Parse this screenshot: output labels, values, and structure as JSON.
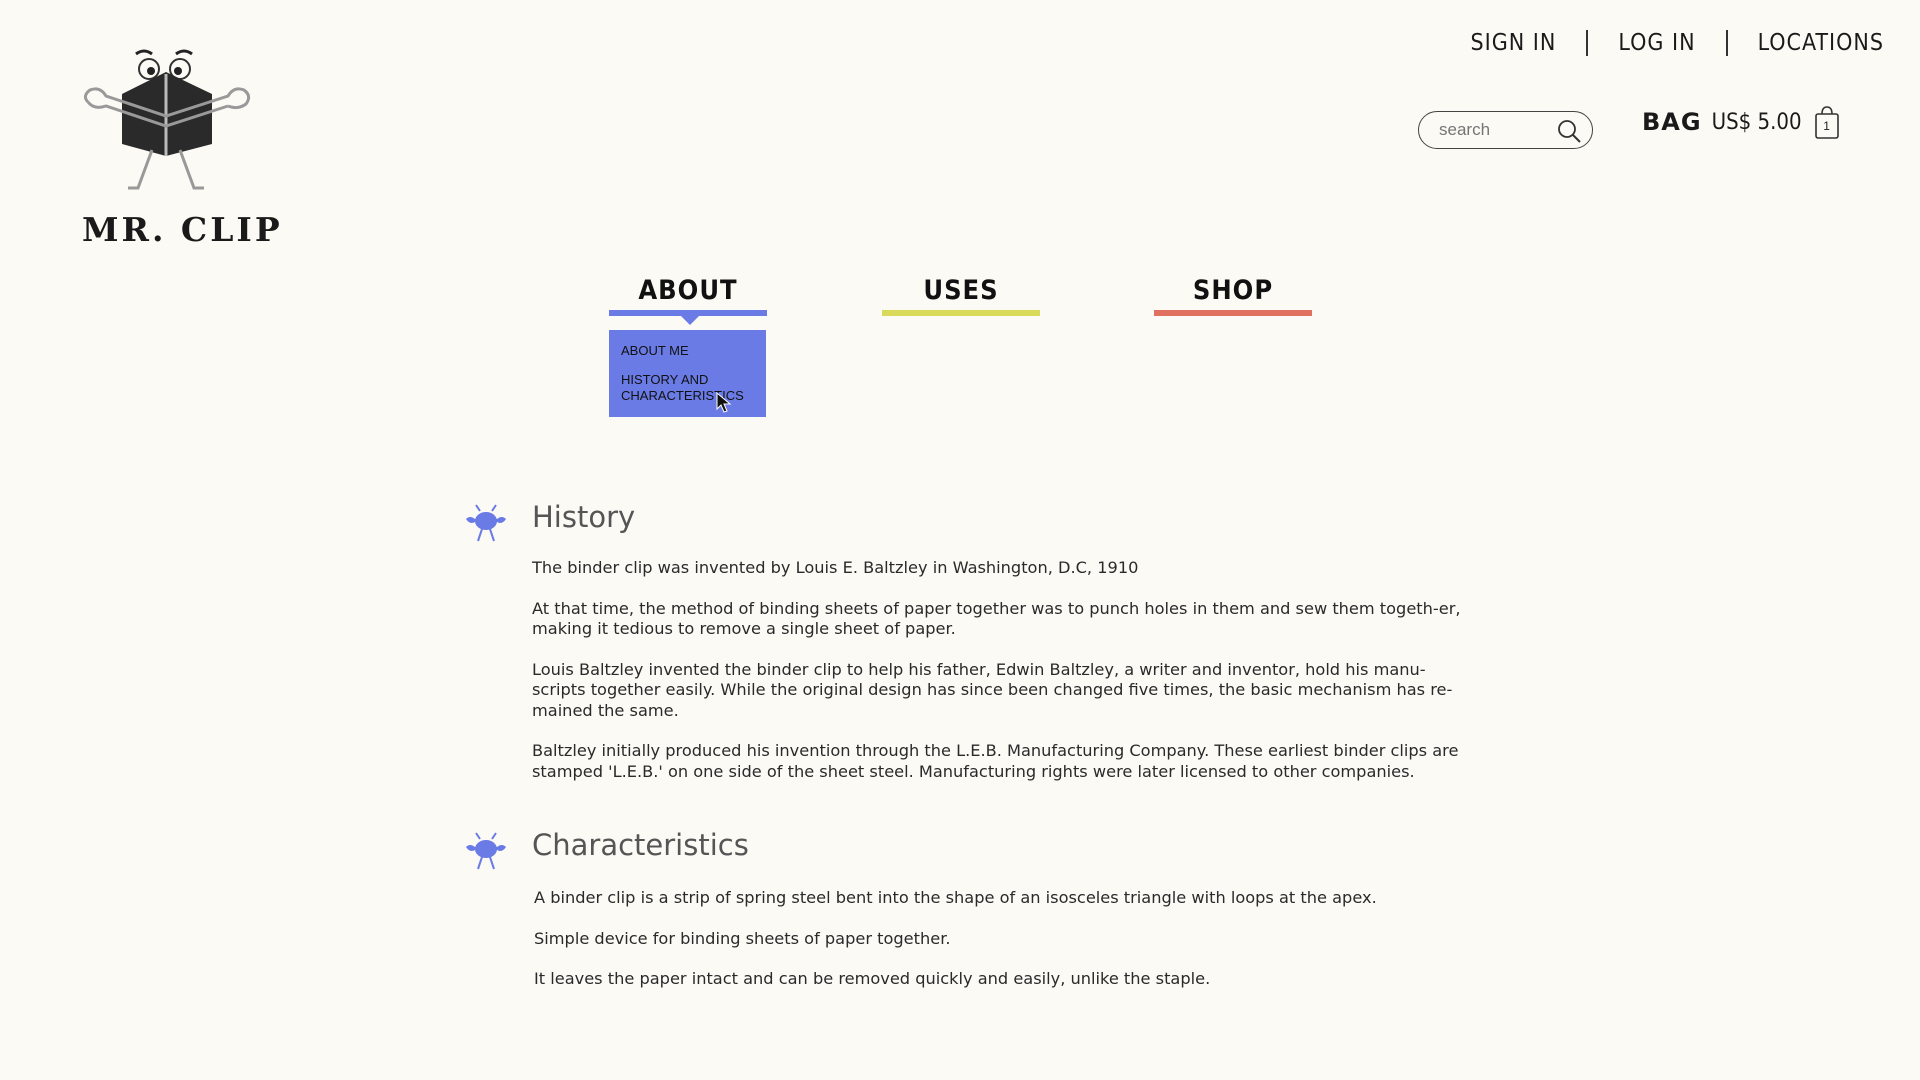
{
  "brand": {
    "name": "MR. CLIP"
  },
  "top_links": {
    "sign_in": "SIGN IN",
    "log_in": "LOG IN",
    "locations": "LOCATIONS"
  },
  "search": {
    "placeholder": "search"
  },
  "bag": {
    "label": "BAG",
    "price": "US$ 5.00",
    "count": "1"
  },
  "nav": {
    "items": [
      {
        "label": "ABOUT",
        "color": "#6a7be5"
      },
      {
        "label": "USES",
        "color": "#d9d95a"
      },
      {
        "label": "SHOP",
        "color": "#e0705f"
      }
    ],
    "dropdown": {
      "items": [
        "ABOUT ME",
        "HISTORY AND CHARACTERISTICS"
      ]
    }
  },
  "history": {
    "title": "History",
    "paragraphs": [
      "The binder clip was invented by Louis E. Baltzley in Washington, D.C, 1910",
      "At that time, the method of binding sheets of paper together was to punch holes in them and sew them togeth-er, making it tedious to remove a single sheet of paper.",
      "Louis Baltzley invented the binder clip to help his father, Edwin Baltzley, a writer and inventor, hold his manu-scripts together easily. While the original design has since been changed five times, the basic mechanism has re-mained the same.",
      "Baltzley initially produced his invention through the L.E.B. Manufacturing Company. These earliest binder clips are stamped 'L.E.B.' on one side of the sheet steel. Manufacturing rights were later licensed to other companies."
    ]
  },
  "characteristics": {
    "title": "Characteristics",
    "paragraphs": [
      "A binder clip is a strip of spring steel bent into the shape of an isosceles triangle with loops at the apex.",
      "Simple device for binding sheets of paper together.",
      "It leaves the paper intact and can be removed quickly and easily, unlike the staple."
    ]
  },
  "colors": {
    "background": "#fcfaf5",
    "accent": "#6a7be5"
  }
}
